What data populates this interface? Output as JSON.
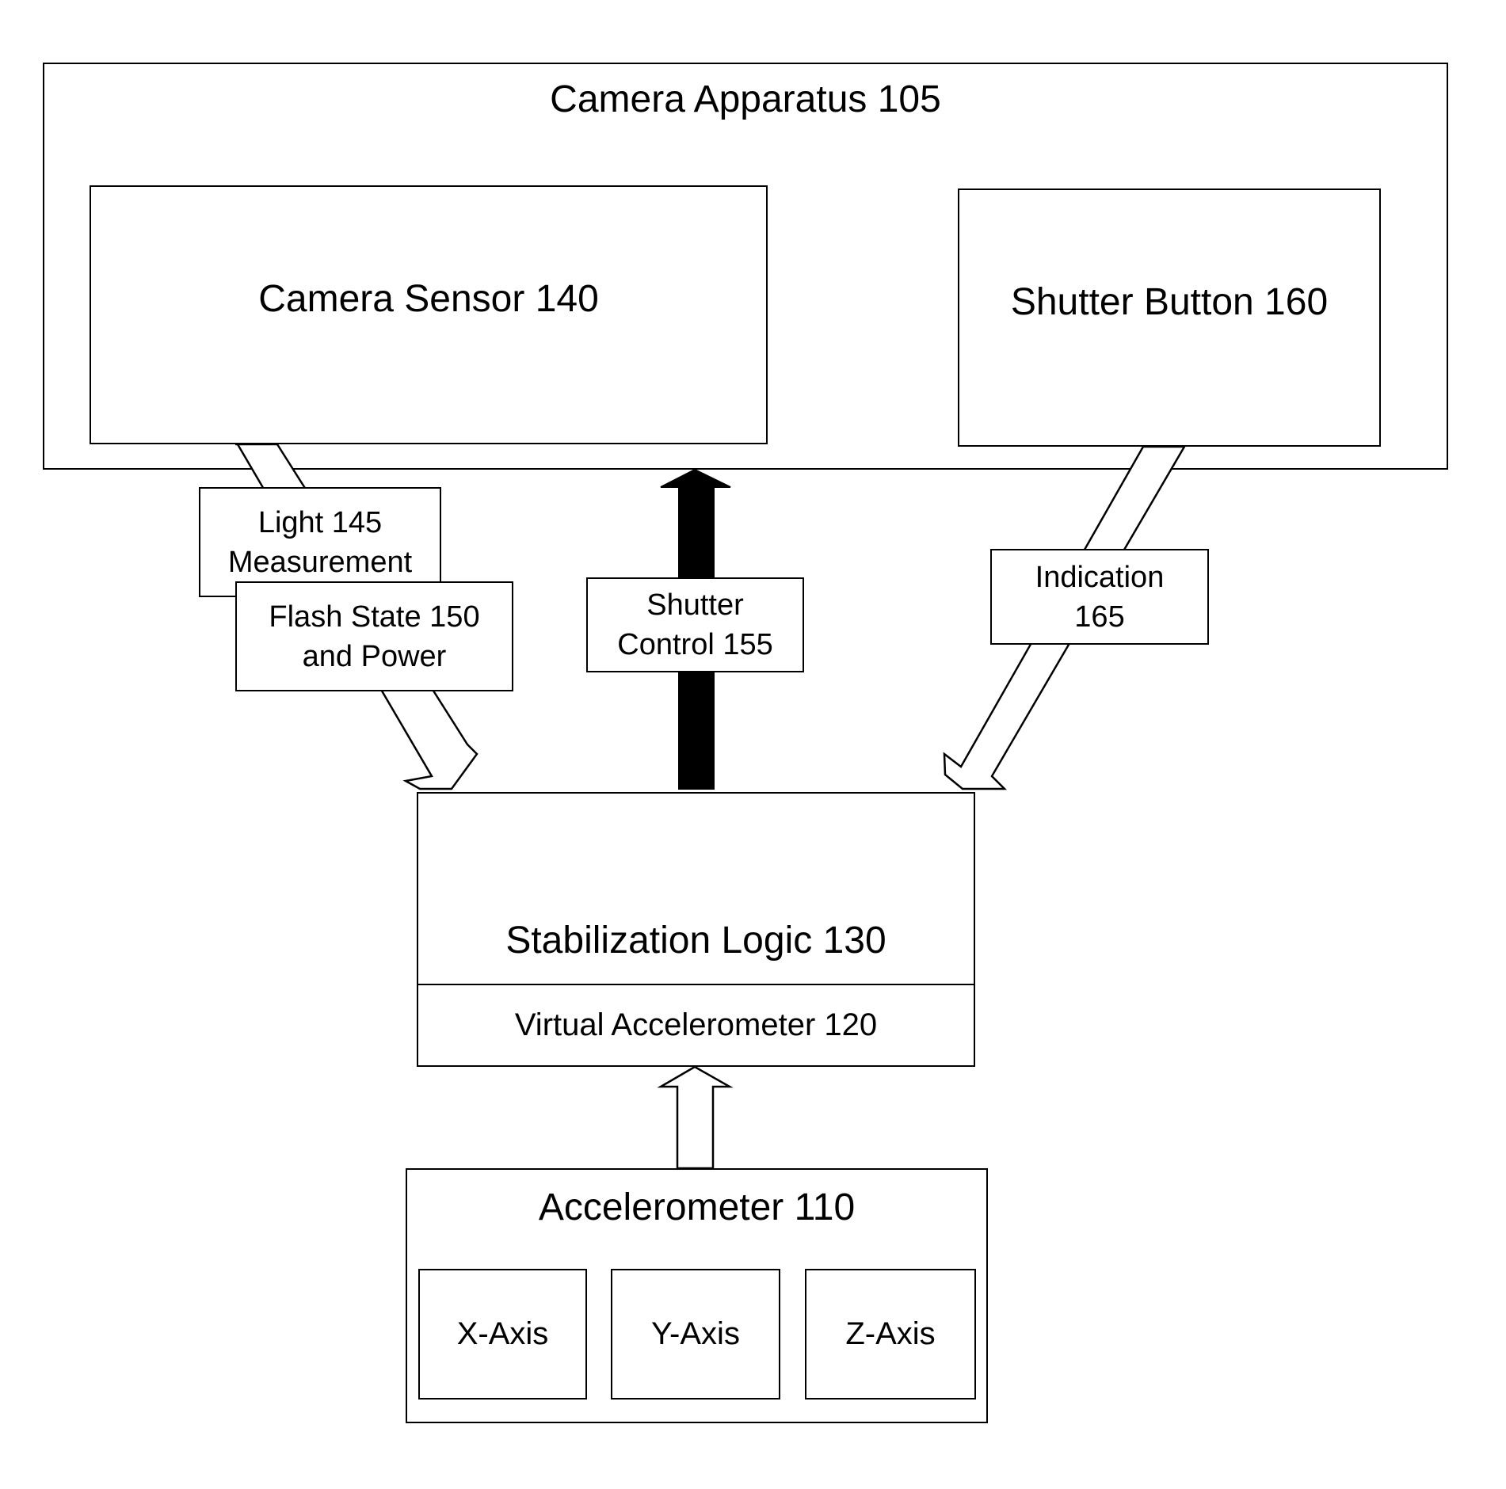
{
  "diagram": {
    "camera_apparatus": {
      "label": "Camera Apparatus 105"
    },
    "camera_sensor": {
      "label": "Camera Sensor 140"
    },
    "shutter_button": {
      "label": "Shutter Button 160"
    },
    "light_measurement": {
      "line1": "Light 145",
      "line2": "Measurement"
    },
    "flash_state": {
      "line1": "Flash State 150",
      "line2": "and Power"
    },
    "shutter_control": {
      "line1": "Shutter",
      "line2": "Control 155"
    },
    "indication": {
      "line1": "Indication",
      "line2": "165"
    },
    "stabilization_logic": {
      "label": "Stabilization Logic 130"
    },
    "virtual_accelerometer": {
      "label": "Virtual Accelerometer 120"
    },
    "accelerometer": {
      "label": "Accelerometer 110",
      "axes": [
        "X-Axis",
        "Y-Axis",
        "Z-Axis"
      ]
    },
    "connections": [
      {
        "from": "Camera Sensor 140",
        "to": "Stabilization Logic 130",
        "style": "hollow-arrow"
      },
      {
        "from": "Stabilization Logic 130",
        "to": "Camera Apparatus 105",
        "style": "solid-black-arrow"
      },
      {
        "from": "Shutter Button 160",
        "to": "Stabilization Logic 130",
        "style": "hollow-arrow"
      },
      {
        "from": "Accelerometer 110",
        "to": "Virtual Accelerometer 120",
        "style": "hollow-arrow"
      }
    ]
  }
}
